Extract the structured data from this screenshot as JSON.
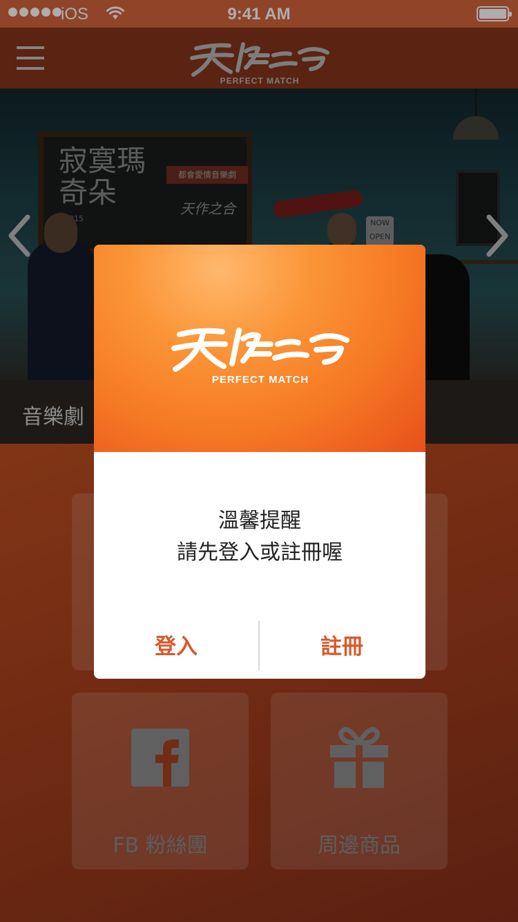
{
  "status_bar": {
    "carrier": "iOS",
    "time": "9:41 AM",
    "signal_icon": "signal-dots-icon",
    "wifi_icon": "wifi-icon",
    "battery_icon": "battery-icon",
    "battery_level": 1.0
  },
  "nav": {
    "menu_icon": "hamburger-menu-icon",
    "logo_tagline": "PERFECT MATCH"
  },
  "hero": {
    "chalkboard_title": "寂寞瑪奇朵",
    "chalkboard_tag": "都會愛情音樂劇",
    "chalkboard_signature": "天作之合",
    "chalkboard_year": "2015",
    "open_sign": "NOW OPEN",
    "prev_icon": "chevron-left-icon",
    "next_icon": "chevron-right-icon",
    "caption": "音樂劇"
  },
  "menu": {
    "tiles": [
      {
        "label": "",
        "icon": ""
      },
      {
        "label": "",
        "icon": ""
      },
      {
        "label": "FB 粉絲團",
        "icon": "facebook-icon"
      },
      {
        "label": "周邊商品",
        "icon": "gift-icon"
      }
    ]
  },
  "modal": {
    "logo_tagline": "PERFECT MATCH",
    "title": "溫馨提醒",
    "message": "請先登入或註冊喔",
    "login_label": "登入",
    "register_label": "註冊"
  },
  "colors": {
    "status_bar": "#d4653c",
    "nav_bar": "#86341a",
    "accent": "#d9592b",
    "modal_header_start": "#fb9436",
    "modal_header_end": "#e8501b"
  }
}
